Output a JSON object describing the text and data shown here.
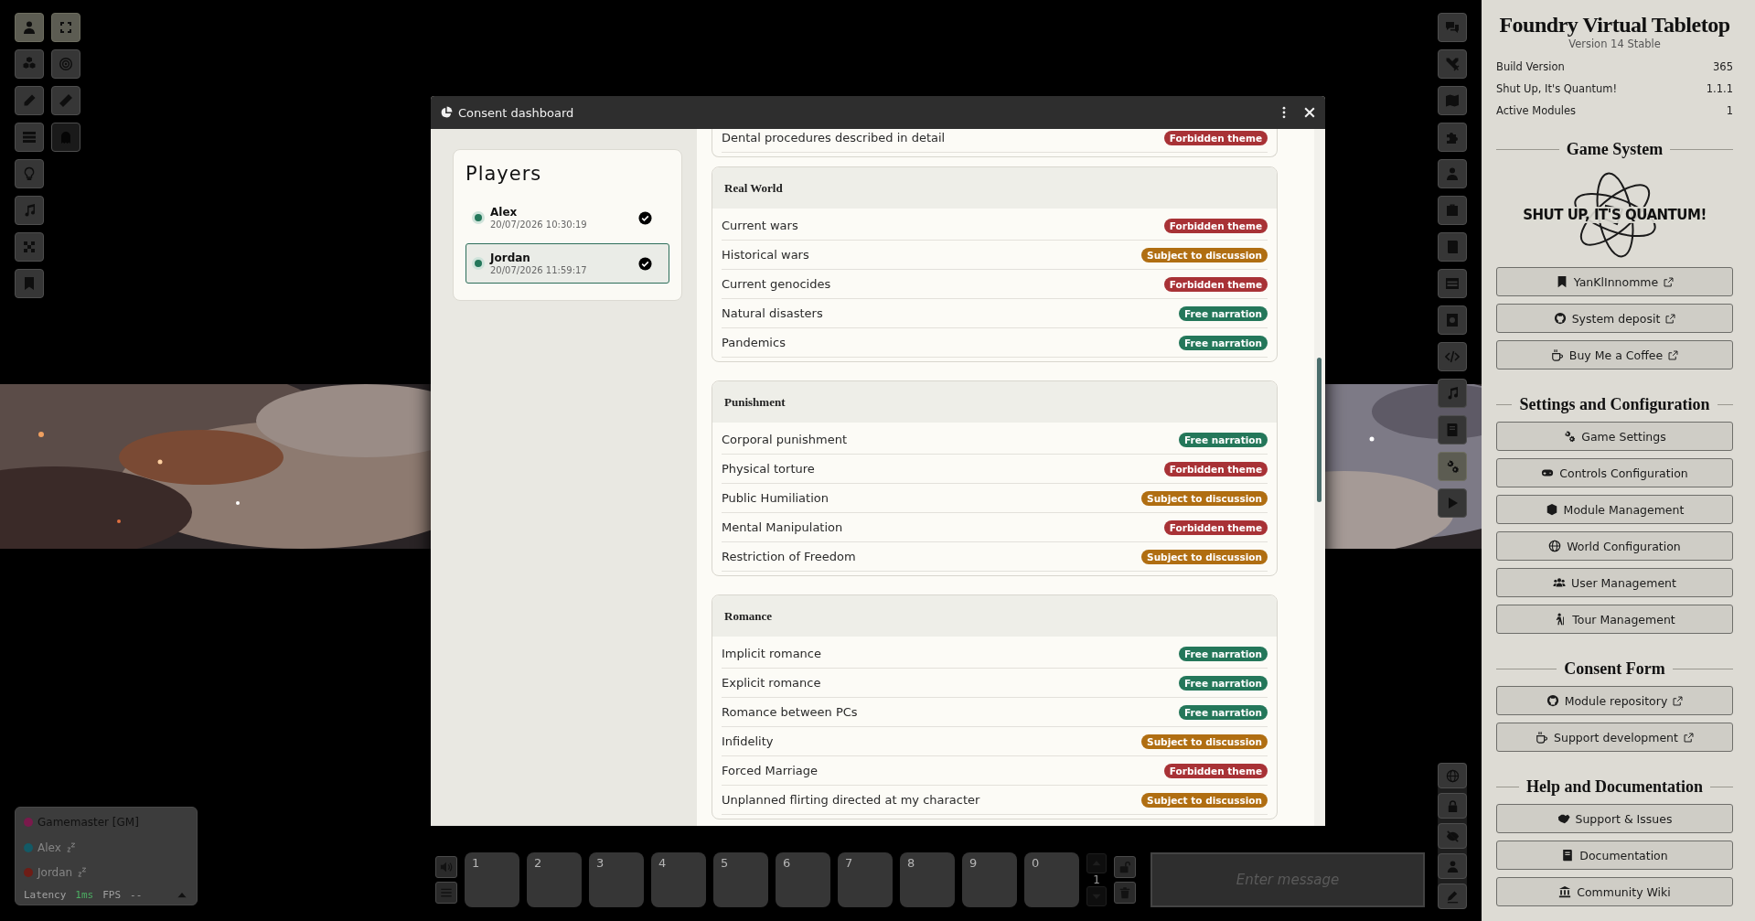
{
  "scene_controls": [
    {
      "selected": true
    },
    {
      "selected": false
    },
    {
      "selected": false
    },
    {
      "selected": false
    },
    {
      "selected": false
    },
    {
      "selected": false
    },
    {
      "selected": false
    },
    {
      "selected": false
    }
  ],
  "tools": [
    {
      "selected": true,
      "disabled": false
    },
    {
      "selected": false,
      "disabled": false
    },
    {
      "selected": false,
      "disabled": false
    },
    {
      "selected": false,
      "disabled": true
    }
  ],
  "dialog": {
    "title": "Consent dashboard",
    "players_title": "Players",
    "players": [
      {
        "name": "Alex",
        "time": "20/07/2026 10:30:19",
        "selected": false
      },
      {
        "name": "Jordan",
        "time": "20/07/2026 11:59:17",
        "selected": true
      }
    ],
    "categories": [
      {
        "rows": [
          {
            "topic": "Dental procedures described in detail",
            "status": "Forbidden theme",
            "color": "#a83236"
          }
        ]
      },
      {
        "title": "Real World",
        "rows": [
          {
            "topic": "Current wars",
            "status": "Forbidden theme",
            "color": "#a83236"
          },
          {
            "topic": "Historical wars",
            "status": "Subject to discussion",
            "color": "#b06e12"
          },
          {
            "topic": "Current genocides",
            "status": "Forbidden theme",
            "color": "#a83236"
          },
          {
            "topic": "Natural disasters",
            "status": "Free narration",
            "color": "#24775a"
          },
          {
            "topic": "Pandemics",
            "status": "Free narration",
            "color": "#24775a"
          }
        ]
      },
      {
        "title": "Punishment",
        "rows": [
          {
            "topic": "Corporal punishment",
            "status": "Free narration",
            "color": "#24775a"
          },
          {
            "topic": "Physical torture",
            "status": "Forbidden theme",
            "color": "#a83236"
          },
          {
            "topic": "Public Humiliation",
            "status": "Subject to discussion",
            "color": "#b06e12"
          },
          {
            "topic": "Mental Manipulation",
            "status": "Forbidden theme",
            "color": "#a83236"
          },
          {
            "topic": "Restriction of Freedom",
            "status": "Subject to discussion",
            "color": "#b06e12"
          }
        ]
      },
      {
        "title": "Romance",
        "rows": [
          {
            "topic": "Implicit romance",
            "status": "Free narration",
            "color": "#24775a"
          },
          {
            "topic": "Explicit romance",
            "status": "Free narration",
            "color": "#24775a"
          },
          {
            "topic": "Romance between PCs",
            "status": "Free narration",
            "color": "#24775a"
          },
          {
            "topic": "Infidelity",
            "status": "Subject to discussion",
            "color": "#b06e12"
          },
          {
            "topic": "Forced Marriage",
            "status": "Forbidden theme",
            "color": "#a83236"
          },
          {
            "topic": "Unplanned flirting directed at my character",
            "status": "Subject to discussion",
            "color": "#b06e12"
          }
        ]
      }
    ]
  },
  "sidebar_tabs": [
    {
      "selected": false
    },
    {
      "selected": false
    },
    {
      "selected": false
    },
    {
      "selected": false
    },
    {
      "selected": false
    },
    {
      "selected": false
    },
    {
      "selected": false
    },
    {
      "selected": false
    },
    {
      "selected": false
    },
    {
      "selected": false
    },
    {
      "selected": false
    },
    {
      "selected": false
    },
    {
      "selected": true
    },
    {
      "selected": false
    }
  ],
  "online_users": [
    {
      "name": "Gamemaster [GM]",
      "color": "#7a1a4c",
      "active": true
    },
    {
      "name": "Alex",
      "color": "#135a66",
      "active": false
    },
    {
      "name": "Jordan",
      "color": "#6e1d16",
      "active": false
    }
  ],
  "performance": {
    "latency_label": "Latency",
    "latency": "1ms",
    "fps_label": "FPS",
    "fps": "--"
  },
  "hotbar": {
    "slots": [
      "1",
      "2",
      "3",
      "4",
      "5",
      "6",
      "7",
      "8",
      "9",
      "0"
    ],
    "page": "1"
  },
  "chat": {
    "placeholder": "Enter message"
  },
  "sidebar": {
    "title": "Foundry Virtual Tabletop",
    "version": "Version 14 Stable",
    "info": [
      {
        "label": "Build Version",
        "value": "365"
      },
      {
        "label": "Shut Up, It's Quantum!",
        "value": "1.1.1"
      },
      {
        "label": "Active Modules",
        "value": "1"
      }
    ],
    "sections": [
      {
        "title": "Game System",
        "logo": "SHUT UP, IT'S QUANTUM!",
        "buttons": [
          {
            "label": "YanKlInnomme",
            "external": true
          },
          {
            "label": "System deposit",
            "external": true
          },
          {
            "label": "Buy Me a Coffee",
            "external": true
          }
        ]
      },
      {
        "title": "Settings and Configuration",
        "buttons": [
          {
            "label": "Game Settings",
            "external": false
          },
          {
            "label": "Controls Configuration",
            "external": false
          },
          {
            "label": "Module Management",
            "external": false
          },
          {
            "label": "World Configuration",
            "external": false
          },
          {
            "label": "User Management",
            "external": false
          },
          {
            "label": "Tour Management",
            "external": false
          }
        ]
      },
      {
        "title": "Consent Form",
        "buttons": [
          {
            "label": "Module repository",
            "external": true
          },
          {
            "label": "Support development",
            "external": true
          }
        ]
      },
      {
        "title": "Help and Documentation",
        "buttons": [
          {
            "label": "Support & Issues",
            "external": false
          },
          {
            "label": "Documentation",
            "external": false
          },
          {
            "label": "Community Wiki",
            "external": false
          }
        ]
      }
    ]
  }
}
